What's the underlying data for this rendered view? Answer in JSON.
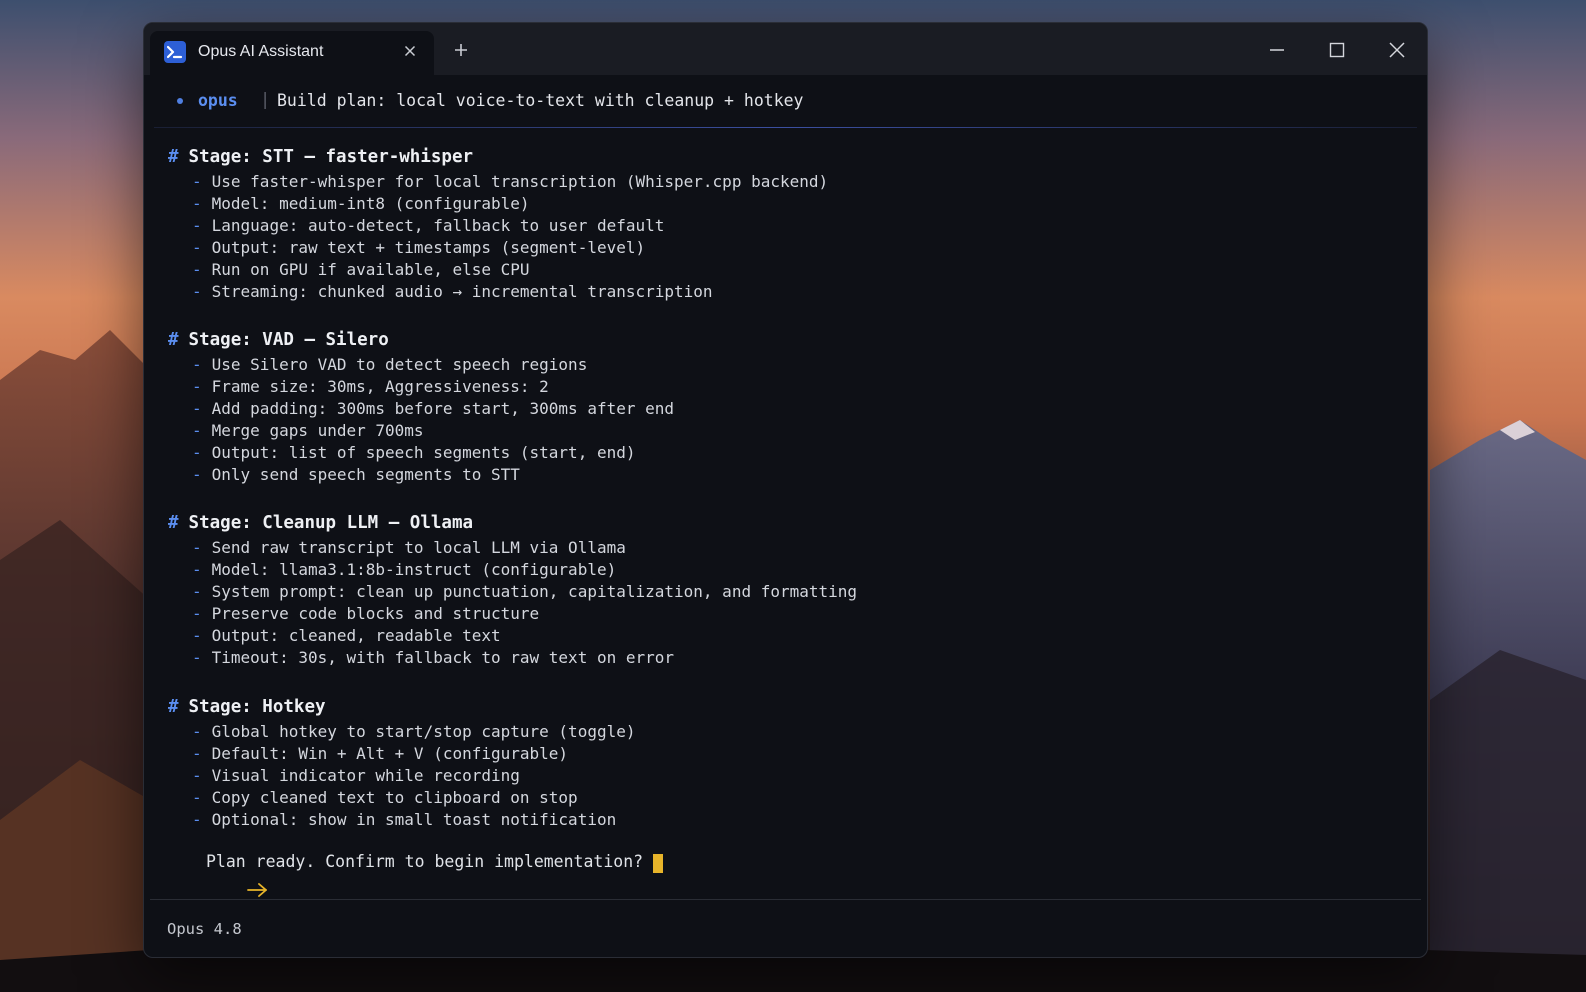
{
  "window": {
    "tab_title": "Opus AI Assistant",
    "tab_icon": "terminal-icon",
    "tab_close_icon": "close-icon",
    "new_tab_icon": "plus-icon",
    "controls": [
      "minimize-icon",
      "maximize-icon",
      "close-icon"
    ]
  },
  "header": {
    "model": "opus",
    "separator": "|",
    "title": "Build plan: local voice-to-text with cleanup + hotkey"
  },
  "sections": [
    {
      "marker": "#",
      "title": "Stage: STT — faster-whisper",
      "items": [
        "Use faster-whisper for local transcription (Whisper.cpp backend)",
        "Model: medium-int8 (configurable)",
        "Language: auto-detect, fallback to user default",
        "Output: raw text + timestamps (segment-level)",
        "Run on GPU if available, else CPU",
        "Streaming: chunked audio → incremental transcription"
      ]
    },
    {
      "marker": "#",
      "title": "Stage: VAD — Silero",
      "items": [
        "Use Silero VAD to detect speech regions",
        "Frame size: 30ms, Aggressiveness: 2",
        "Add padding: 300ms before start, 300ms after end",
        "Merge gaps under 700ms",
        "Output: list of speech segments (start, end)",
        "Only send speech segments to STT"
      ]
    },
    {
      "marker": "#",
      "title": "Stage: Cleanup LLM — Ollama",
      "items": [
        "Send raw transcript to local LLM via Ollama",
        "Model: llama3.1:8b-instruct (configurable)",
        "System prompt: clean up punctuation, capitalization, and formatting",
        "Preserve code blocks and structure",
        "Output: cleaned, readable text",
        "Timeout: 30s, with fallback to raw text on error"
      ]
    },
    {
      "marker": "#",
      "title": "Stage: Hotkey",
      "items": [
        "Global hotkey to start/stop capture (toggle)",
        "Default: Win + Alt + V (configurable)",
        "Visual indicator while recording",
        "Copy cleaned text to clipboard on stop",
        "Optional: show in small toast notification"
      ]
    }
  ],
  "bullet": "-",
  "prompt": {
    "icon": "arrow-right-icon",
    "text": "Plan ready. Confirm to begin implementation?",
    "cursor_color": "#e7b42a"
  },
  "footer": {
    "version": "Opus 4.8"
  },
  "colors": {
    "accent": "#5b8ef0",
    "background": "#0e1016",
    "titlebar": "#1a1c23",
    "text": "#d4d7de"
  }
}
